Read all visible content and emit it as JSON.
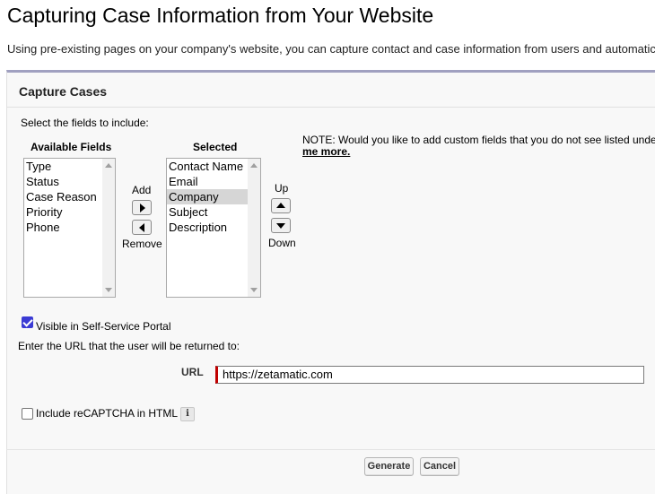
{
  "page": {
    "title": "Capturing Case Information from Your Website",
    "intro": "Using pre-existing pages on your company's website, you can capture contact and case information from users and automatically generate new cases."
  },
  "panel": {
    "title": "Capture Cases",
    "select_fields_label": "Select the fields to include:",
    "available_label": "Available Fields",
    "selected_label": "Selected",
    "available_fields": [
      "Type",
      "Status",
      "Case Reason",
      "Priority",
      "Phone"
    ],
    "selected_fields": [
      "Contact Name",
      "Email",
      "Company",
      "Subject",
      "Description"
    ],
    "highlighted_selected_field": "Company",
    "add_label": "Add",
    "remove_label": "Remove",
    "up_label": "Up",
    "down_label": "Down",
    "note_text": "NOTE: Would you like to add custom fields that you do not see listed unde",
    "note_link": "me more.",
    "visible_portal_label": "Visible in Self-Service Portal",
    "visible_portal_checked": true,
    "return_url_label": "Enter the URL that the user will be returned to:",
    "url_label": "URL",
    "url_value": "https://zetamatic.com",
    "recaptcha_label": "Include reCAPTCHA in HTML",
    "recaptcha_checked": false,
    "info_glyph": "i",
    "generate_label": "Generate",
    "cancel_label": "Cancel"
  }
}
